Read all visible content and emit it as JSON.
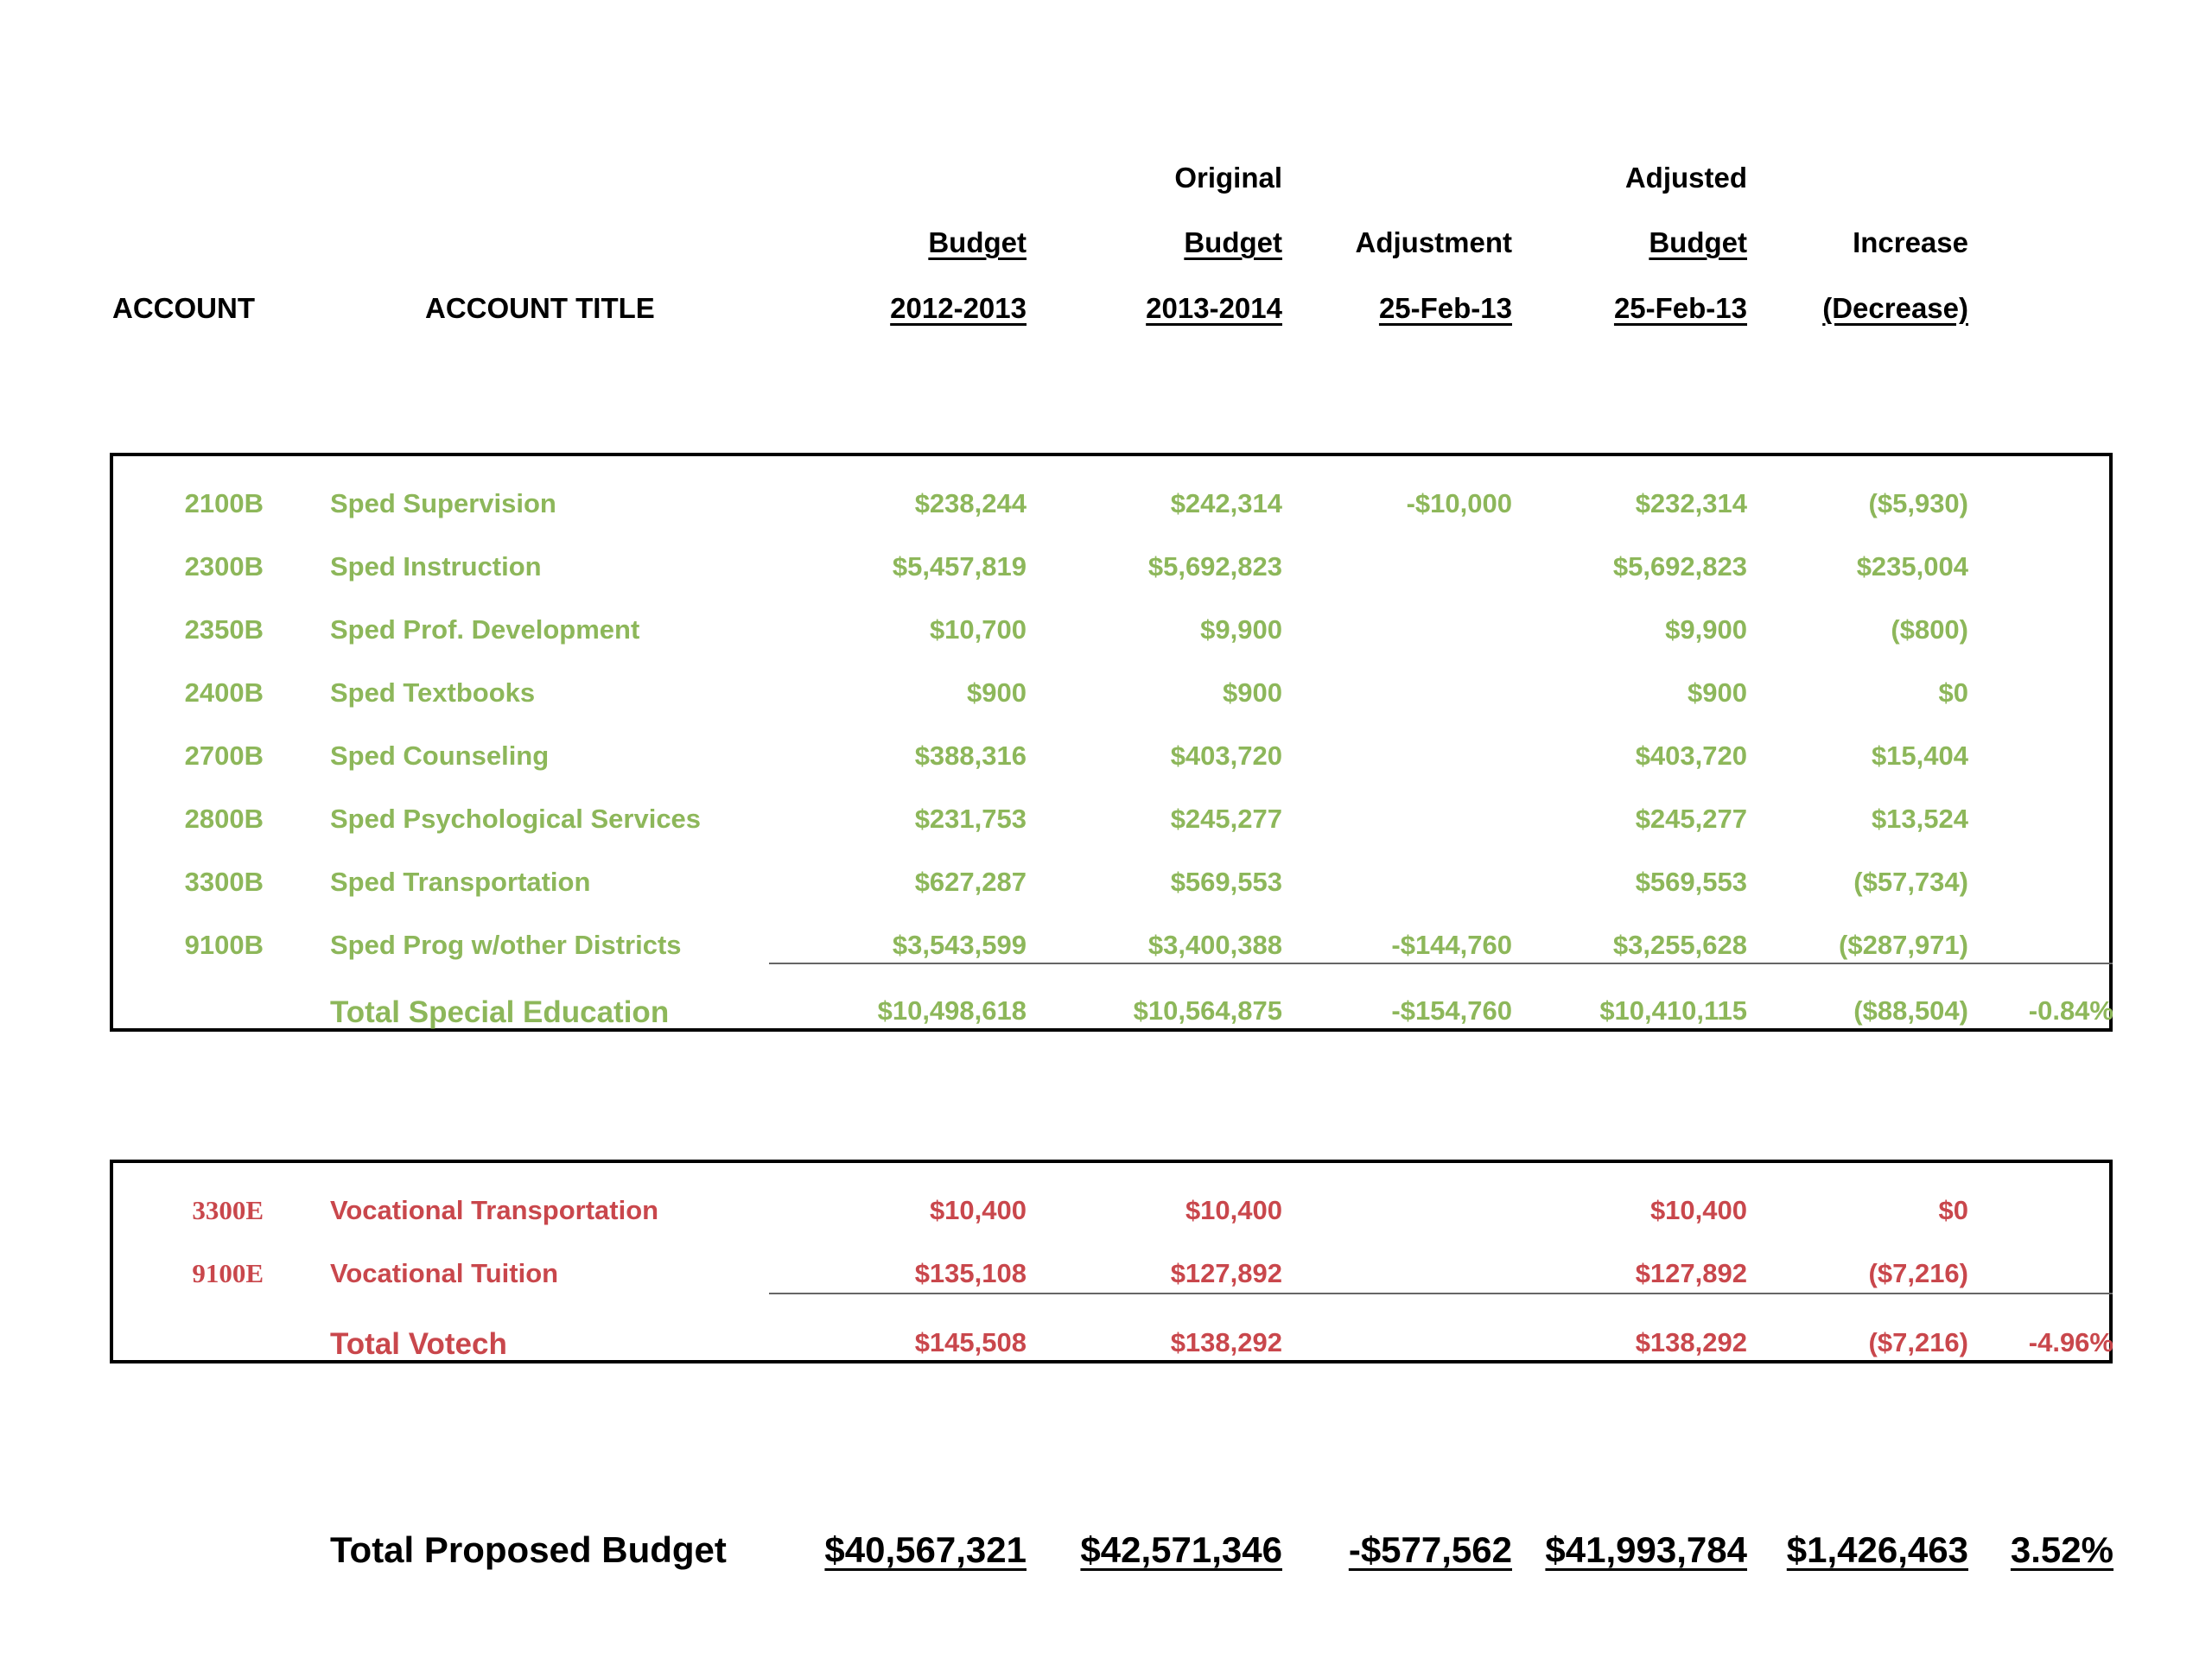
{
  "headers": {
    "account": "ACCOUNT",
    "account_title": "ACCOUNT TITLE",
    "col1": {
      "line2": "Budget",
      "line3": "2012-2013"
    },
    "col2": {
      "line1": "Original",
      "line2": "Budget",
      "line3": "2013-2014"
    },
    "col3": {
      "line2": "Adjustment",
      "line3": "25-Feb-13"
    },
    "col4": {
      "line1": "Adjusted",
      "line2": "Budget",
      "line3": "25-Feb-13"
    },
    "col5": {
      "line2": "Increase",
      "line3": "(Decrease)"
    }
  },
  "sped": {
    "color": "#8db75a",
    "rows": [
      {
        "account": "2100B",
        "title": "Sped Supervision",
        "budget_2012": "$238,244",
        "budget_2013": "$242,314",
        "adjustment": "-$10,000",
        "adjusted": "$232,314",
        "change": "($5,930)"
      },
      {
        "account": "2300B",
        "title": "Sped Instruction",
        "budget_2012": "$5,457,819",
        "budget_2013": "$5,692,823",
        "adjustment": "",
        "adjusted": "$5,692,823",
        "change": "$235,004"
      },
      {
        "account": "2350B",
        "title": "Sped Prof. Development",
        "budget_2012": "$10,700",
        "budget_2013": "$9,900",
        "adjustment": "",
        "adjusted": "$9,900",
        "change": "($800)"
      },
      {
        "account": "2400B",
        "title": "Sped Textbooks",
        "budget_2012": "$900",
        "budget_2013": "$900",
        "adjustment": "",
        "adjusted": "$900",
        "change": "$0"
      },
      {
        "account": "2700B",
        "title": "Sped Counseling",
        "budget_2012": "$388,316",
        "budget_2013": "$403,720",
        "adjustment": "",
        "adjusted": "$403,720",
        "change": "$15,404"
      },
      {
        "account": "2800B",
        "title": "Sped Psychological Services",
        "budget_2012": "$231,753",
        "budget_2013": "$245,277",
        "adjustment": "",
        "adjusted": "$245,277",
        "change": "$13,524"
      },
      {
        "account": "3300B",
        "title": "Sped Transportation",
        "budget_2012": "$627,287",
        "budget_2013": "$569,553",
        "adjustment": "",
        "adjusted": "$569,553",
        "change": "($57,734)"
      },
      {
        "account": "9100B",
        "title": "Sped Prog w/other Districts",
        "budget_2012": "$3,543,599",
        "budget_2013": "$3,400,388",
        "adjustment": "-$144,760",
        "adjusted": "$3,255,628",
        "change": "($287,971)"
      }
    ],
    "total": {
      "title": "Total Special Education",
      "budget_2012": "$10,498,618",
      "budget_2013": "$10,564,875",
      "adjustment": "-$154,760",
      "adjusted": "$10,410,115",
      "change": "($88,504)",
      "percent": "-0.84%"
    }
  },
  "votech": {
    "color": "#c9474c",
    "rows": [
      {
        "account": "3300E",
        "title": "Vocational Transportation",
        "budget_2012": "$10,400",
        "budget_2013": "$10,400",
        "adjustment": "",
        "adjusted": "$10,400",
        "change": "$0"
      },
      {
        "account": "9100E",
        "title": "Vocational Tuition",
        "budget_2012": "$135,108",
        "budget_2013": "$127,892",
        "adjustment": "",
        "adjusted": "$127,892",
        "change": "($7,216)"
      }
    ],
    "total": {
      "title": "Total Votech",
      "budget_2012": "$145,508",
      "budget_2013": "$138,292",
      "adjustment": "",
      "adjusted": "$138,292",
      "change": "($7,216)",
      "percent": "-4.96%"
    }
  },
  "grand_total": {
    "title": "Total Proposed Budget",
    "budget_2012": "$40,567,321",
    "budget_2013": "$42,571,346",
    "adjustment": "-$577,562",
    "adjusted": "$41,993,784",
    "change": "$1,426,463",
    "percent": "3.52%"
  }
}
